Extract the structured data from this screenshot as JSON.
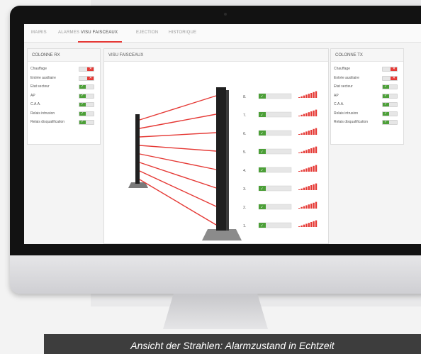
{
  "tabs": [
    {
      "label": "MAIRIS",
      "active": false
    },
    {
      "label": "ALARMES",
      "active": false
    },
    {
      "label": "VISU FAISCEAUX",
      "active": true
    },
    {
      "label": "EJECTION",
      "active": false
    },
    {
      "label": "HISTORIQUE",
      "active": false
    }
  ],
  "rx_panel": {
    "title": "COLONNE RX",
    "rows": [
      {
        "label": "Chauffage",
        "state": "red"
      },
      {
        "label": "Entrée auxiliaire",
        "state": "red"
      },
      {
        "label": "Etat secteur",
        "state": "green"
      },
      {
        "label": "AP",
        "state": "green"
      },
      {
        "label": "C.A.A.",
        "state": "green"
      },
      {
        "label": "Relais intrusion",
        "state": "green"
      },
      {
        "label": "Relais disqualification",
        "state": "green"
      }
    ]
  },
  "beam_panel": {
    "title": "VISU FAISCEAUX",
    "beams": [
      {
        "number": "8.",
        "status": "ok",
        "signal": 1.0
      },
      {
        "number": "7.",
        "status": "ok",
        "signal": 1.0
      },
      {
        "number": "6.",
        "status": "ok",
        "signal": 1.0
      },
      {
        "number": "5.",
        "status": "ok",
        "signal": 1.0
      },
      {
        "number": "4.",
        "status": "ok",
        "signal": 1.0
      },
      {
        "number": "3.",
        "status": "ok",
        "signal": 1.0
      },
      {
        "number": "2.",
        "status": "ok",
        "signal": 1.0
      },
      {
        "number": "1.",
        "status": "ok",
        "signal": 1.0
      }
    ]
  },
  "tx_panel": {
    "title": "COLONNE TX",
    "rows": [
      {
        "label": "Chauffage",
        "state": "red"
      },
      {
        "label": "Entrée auxiliaire",
        "state": "red"
      },
      {
        "label": "Etat secteur",
        "state": "green"
      },
      {
        "label": "AP",
        "state": "green"
      },
      {
        "label": "C.A.A.",
        "state": "green"
      },
      {
        "label": "Relais intrusion",
        "state": "green"
      },
      {
        "label": "Relais disqualification",
        "state": "green"
      }
    ]
  },
  "caption": "Ansicht der Strahlen: Alarmzustand in Echtzeit",
  "colors": {
    "alarm_red": "#e53935",
    "ok_green": "#4c9f38",
    "column_dark": "#1f1f1f",
    "caption_bg": "#3d3d3d"
  },
  "icons": {
    "indicator_red": "cross-mark",
    "indicator_green": "check-mark"
  }
}
